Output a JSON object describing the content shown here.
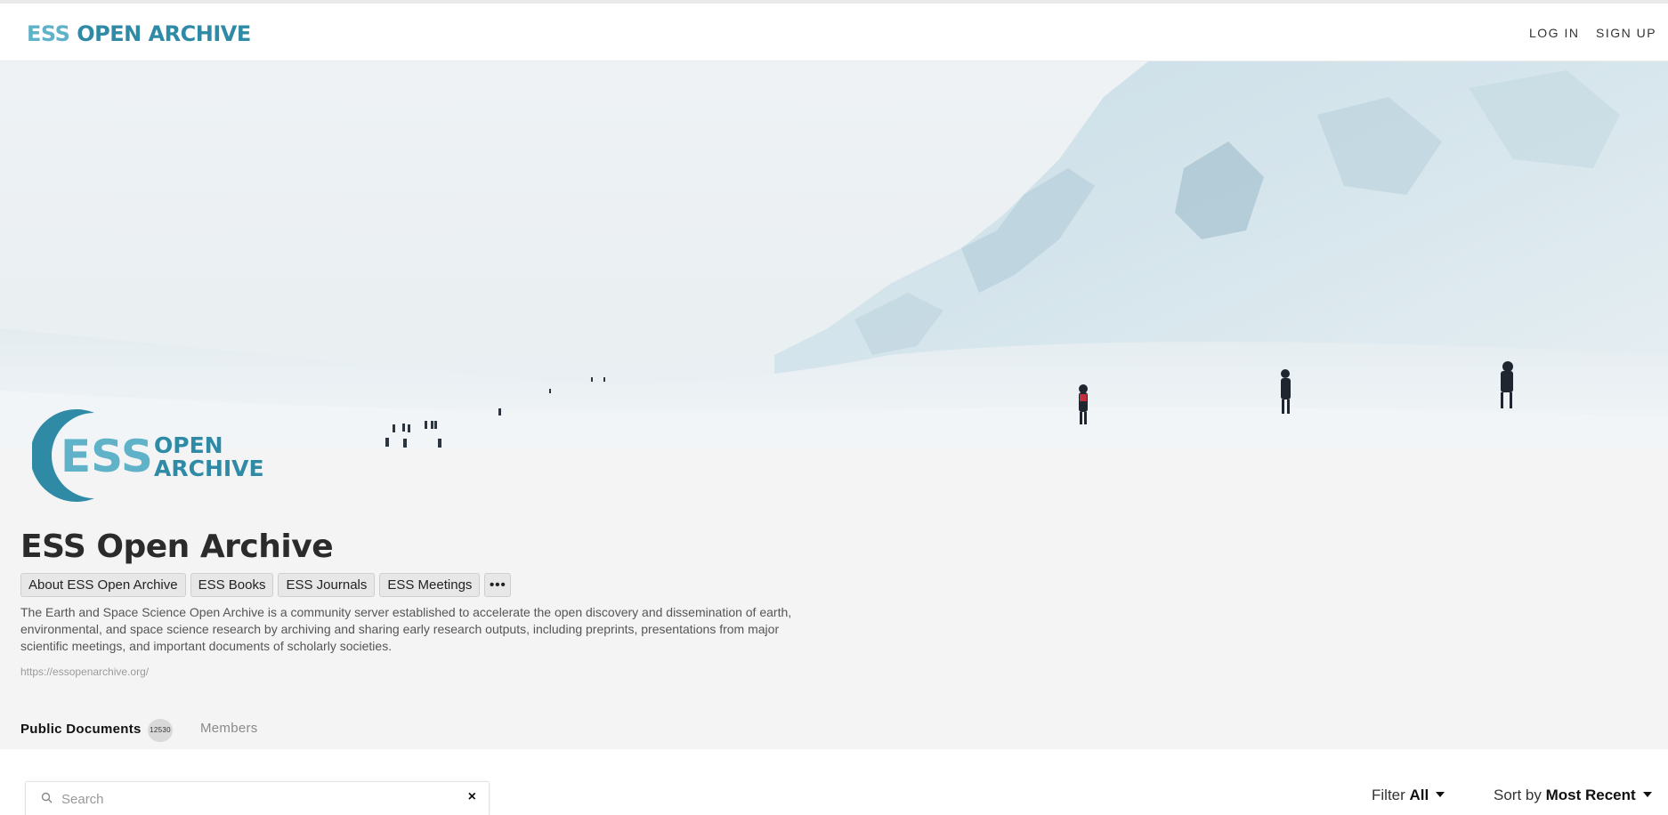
{
  "header": {
    "brand_prefix": "ESS",
    "brand_rest": "OPEN ARCHIVE",
    "login_label": "LOG IN",
    "signup_label": "SIGN UP"
  },
  "hero": {
    "image": "snowy-glacier-climbers"
  },
  "logo": {
    "line1": "ESS",
    "line2": "OPEN",
    "line3": "ARCHIVE"
  },
  "group": {
    "title": "ESS Open Archive",
    "links": [
      "About ESS Open Archive",
      "ESS Books",
      "ESS Journals",
      "ESS Meetings"
    ],
    "more_label": "•••",
    "description": "The Earth and Space Science Open Archive is a community server established to accelerate the open discovery and dissemination of earth, environmental, and space science research by archiving and sharing early research outputs, including preprints, presentations from major scientific meetings, and important documents of scholarly societies.",
    "url": "https://essopenarchive.org/"
  },
  "tabs": {
    "public_label": "Public Documents",
    "public_count": "12530",
    "members_label": "Members"
  },
  "toolbar": {
    "search_placeholder": "Search",
    "clear_icon": "×",
    "filter_label": "Filter",
    "filter_value": "All",
    "sort_label": "Sort by",
    "sort_value": "Most Recent"
  },
  "colors": {
    "brand": "#2f8aa5",
    "brand_light": "#5fb2c8",
    "background": "#f4f4f4"
  }
}
